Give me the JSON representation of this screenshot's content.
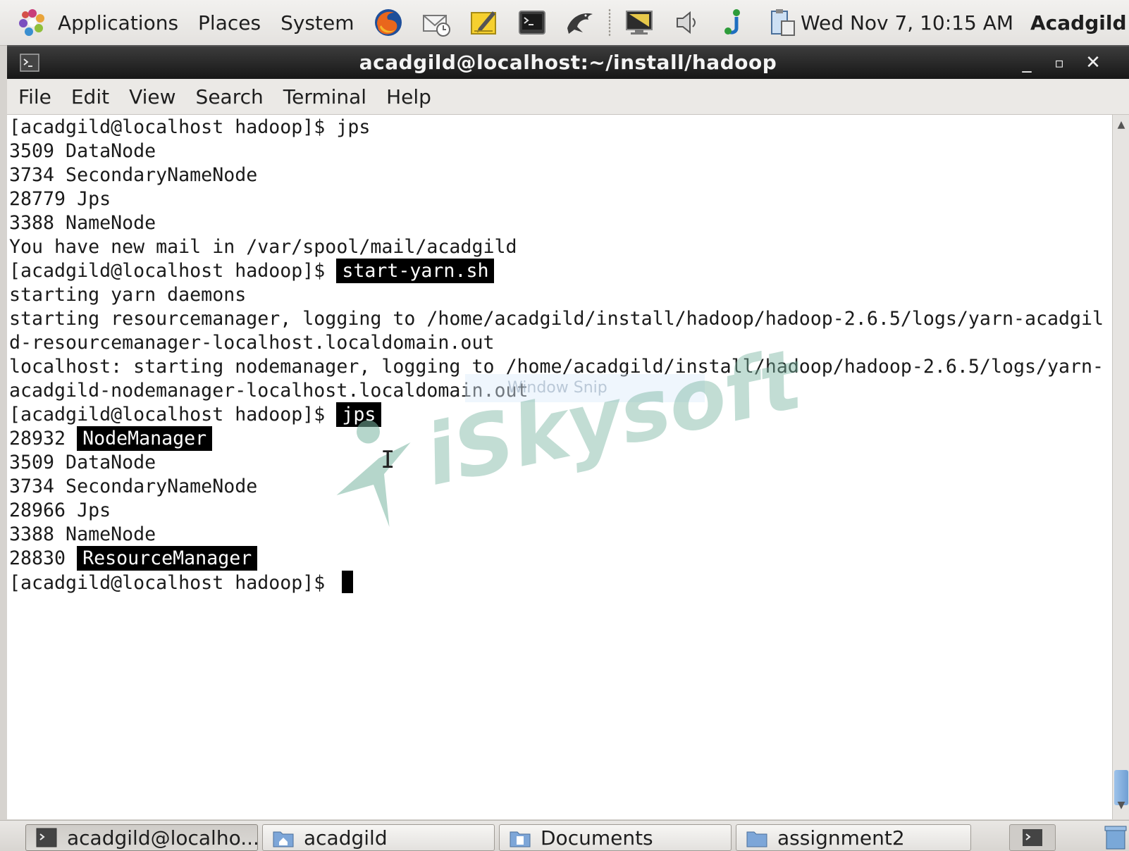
{
  "top_panel": {
    "menus": [
      "Applications",
      "Places",
      "System"
    ],
    "launchers": [
      "firefox-icon",
      "mail-icon",
      "notes-icon",
      "terminal-icon",
      "dolphin-icon"
    ],
    "tray": [
      "display-icon",
      "volume-icon",
      "network-icon",
      "clipboard-icon"
    ],
    "clock": "Wed Nov  7, 10:15 AM",
    "user": "Acadgild"
  },
  "window": {
    "title": "acadgild@localhost:~/install/hadoop",
    "controls": [
      "_",
      "▫",
      "✕"
    ]
  },
  "menubar": [
    "File",
    "Edit",
    "View",
    "Search",
    "Terminal",
    "Help"
  ],
  "terminal": {
    "lines": [
      {
        "text": "[acadgild@localhost hadoop]$ jps"
      },
      {
        "text": "3509 DataNode"
      },
      {
        "text": "3734 SecondaryNameNode"
      },
      {
        "text": "28779 Jps"
      },
      {
        "text": "3388 NameNode"
      },
      {
        "text": "You have new mail in /var/spool/mail/acadgild"
      },
      {
        "text": "[acadgild@localhost hadoop]$ ",
        "highlight": "start-yarn.sh"
      },
      {
        "text": "starting yarn daemons"
      },
      {
        "text": "starting resourcemanager, logging to /home/acadgild/install/hadoop/hadoop-2.6.5/logs/yarn-acadgil"
      },
      {
        "text": "d-resourcemanager-localhost.localdomain.out"
      },
      {
        "text": "localhost: starting nodemanager, logging to /home/acadgild/install/hadoop/hadoop-2.6.5/logs/yarn-"
      },
      {
        "text": "acadgild-nodemanager-localhost.localdomain.out"
      },
      {
        "text": "[acadgild@localhost hadoop]$ ",
        "highlight": "jps"
      },
      {
        "text": "28932 ",
        "highlight": "NodeManager"
      },
      {
        "text": "3509 DataNode"
      },
      {
        "text": "3734 SecondaryNameNode"
      },
      {
        "text": "28966 Jps"
      },
      {
        "text": "3388 NameNode"
      },
      {
        "text": "28830 ",
        "highlight": "ResourceManager"
      },
      {
        "text": "[acadgild@localhost hadoop]$ ",
        "cursor": true
      }
    ]
  },
  "overlay": {
    "watermark": "iSkysoft",
    "snip_label": "Window Snip"
  },
  "taskbar": {
    "items": [
      {
        "label": "acadgild@localho...",
        "icon": "terminal-icon",
        "active": true
      },
      {
        "label": "acadgild",
        "icon": "home-folder-icon",
        "active": false
      },
      {
        "label": "Documents",
        "icon": "documents-folder-icon",
        "active": false
      },
      {
        "label": "assignment2",
        "icon": "folder-icon",
        "active": false
      }
    ]
  },
  "colors": {
    "titlebar": "#1e1e1e",
    "highlight_bg": "#000000",
    "terminal_bg": "#ffffff",
    "watermark": "#78b4a0"
  }
}
